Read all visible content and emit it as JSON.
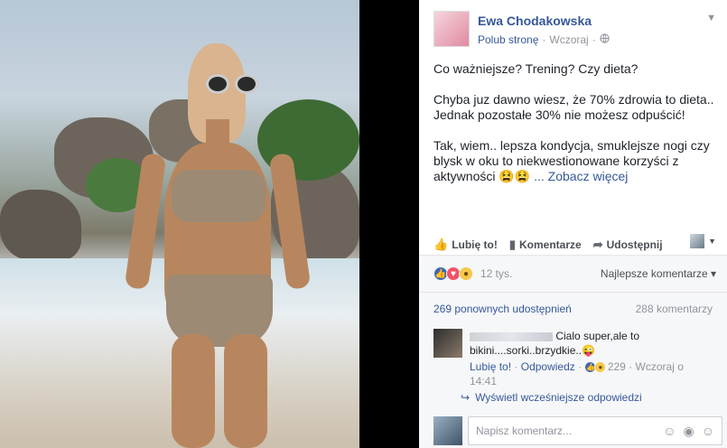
{
  "post": {
    "page_name": "Ewa Chodakowska",
    "like_page": "Polub stronę",
    "dot": "·",
    "time": "Wczoraj",
    "globe_icon": "globe-icon",
    "paragraphs": [
      "Co ważniejsze? Trening? Czy dieta?",
      "Chyba juz dawno wiesz, że 70% zdrowia to dieta.. Jednak pozostałe 30% nie możesz odpuścić!",
      "Tak, wiem.. lepsza kondycja, smuklejsze nogi czy blysk w oku to niekwestionowane korzyści z aktywności 😫😫"
    ],
    "see_more": "... Zobacz więcej"
  },
  "actions": {
    "like": "Lubię to!",
    "comment": "Komentarze",
    "share": "Udostępnij"
  },
  "reactions": {
    "count": "12 tys.",
    "sort": "Najlepsze komentarze"
  },
  "stats": {
    "shares": "269 ponownych udostępnień",
    "comments": "288 komentarzy"
  },
  "comment": {
    "text": "Cialo super,ale to bikini....sorki..brzydkie..😜",
    "like": "Lubię to!",
    "reply": "Odpowiedz",
    "dot": "·",
    "react_count": "229",
    "time": "Wczoraj o 14:41"
  },
  "more_replies": "Wyświetl wcześniejsze odpowiedzi",
  "comment_input": {
    "placeholder": "Napisz komentarz..."
  },
  "colors": {
    "link": "#365899",
    "muted": "#90949c",
    "panel": "#f6f7f9"
  }
}
